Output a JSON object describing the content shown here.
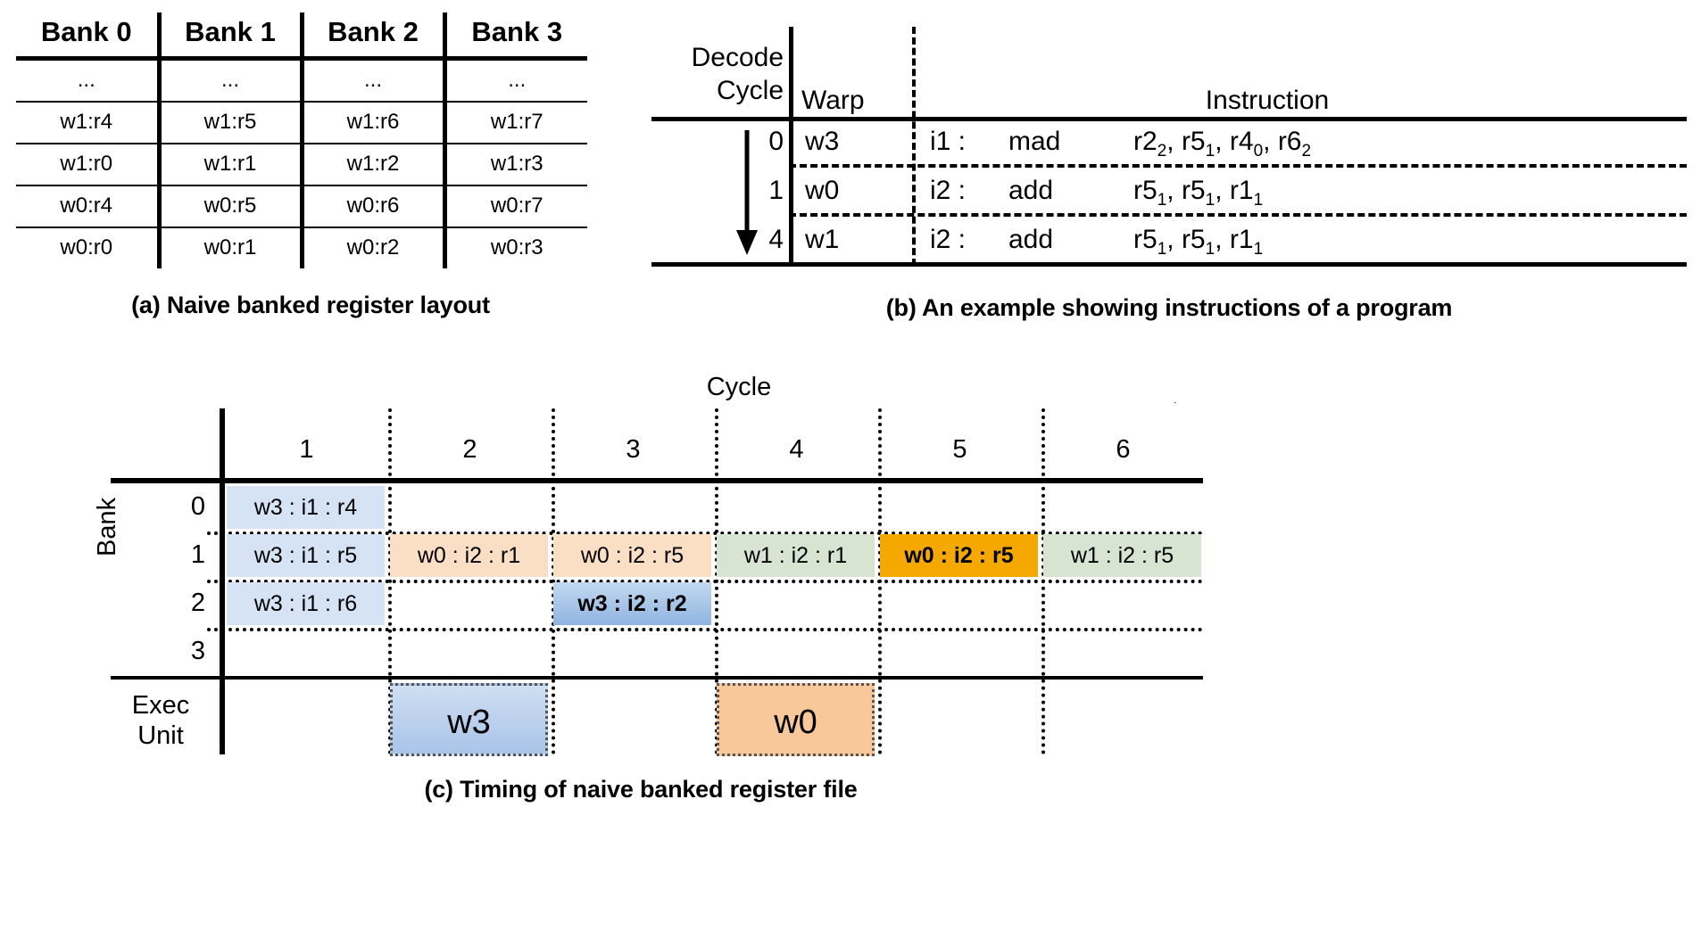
{
  "panel_a": {
    "caption": "(a) Naive banked register layout",
    "headers": [
      "Bank 0",
      "Bank 1",
      "Bank 2",
      "Bank 3"
    ],
    "rows": [
      [
        "...",
        "...",
        "...",
        "..."
      ],
      [
        "w1:r4",
        "w1:r5",
        "w1:r6",
        "w1:r7"
      ],
      [
        "w1:r0",
        "w1:r1",
        "w1:r2",
        "w1:r3"
      ],
      [
        "w0:r4",
        "w0:r5",
        "w0:r6",
        "w0:r7"
      ],
      [
        "w0:r0",
        "w0:r1",
        "w0:r2",
        "w0:r3"
      ]
    ]
  },
  "panel_b": {
    "caption": "(b) An example showing instructions of a program",
    "header": {
      "decode_cycle_line1": "Decode",
      "decode_cycle_line2": "Cycle",
      "warp": "Warp",
      "instruction": "Instruction"
    },
    "rows": [
      {
        "cycle": "0",
        "warp": "w3",
        "id": "i1 :",
        "mnemonic": "mad",
        "operands": [
          {
            "reg": "r2",
            "sub": "2",
            "sep": ", "
          },
          {
            "reg": "r5",
            "sub": "1",
            "sep": ", "
          },
          {
            "reg": "r4",
            "sub": "0",
            "sep": ", "
          },
          {
            "reg": "r6",
            "sub": "2",
            "sep": ""
          }
        ]
      },
      {
        "cycle": "1",
        "warp": "w0",
        "id": "i2 :",
        "mnemonic": "add",
        "operands": [
          {
            "reg": "r5",
            "sub": "1",
            "sep": ", "
          },
          {
            "reg": "r5",
            "sub": "1",
            "sep": ", "
          },
          {
            "reg": "r1",
            "sub": "1",
            "sep": ""
          }
        ]
      },
      {
        "cycle": "4",
        "warp": "w1",
        "id": "i2 :",
        "mnemonic": "add",
        "operands": [
          {
            "reg": "r5",
            "sub": "1",
            "sep": ", "
          },
          {
            "reg": "r5",
            "sub": "1",
            "sep": ", "
          },
          {
            "reg": "r1",
            "sub": "1",
            "sep": ""
          }
        ]
      }
    ]
  },
  "panel_c": {
    "caption": "(c) Timing of naive banked register file",
    "axis_label": "Cycle",
    "row_group_label": "Bank",
    "exec_label_line1": "Exec",
    "exec_label_line2": "Unit",
    "cycles": [
      "1",
      "2",
      "3",
      "4",
      "5",
      "6"
    ],
    "bank_rows": [
      "0",
      "1",
      "2",
      "3"
    ],
    "colors": {
      "blue_light": "#d6e3f5",
      "blue_strong": "#8fb4e0",
      "peach": "#fbdfc4",
      "green": "#d7e4d2",
      "orange": "#f5a800",
      "exec_blue": "#a9c4e8",
      "exec_orange": "#f8c89a"
    },
    "cells": [
      {
        "bank": "0",
        "cycle": "1",
        "text": "w3 : i1 : r4",
        "color": "blue_light",
        "bold": false
      },
      {
        "bank": "1",
        "cycle": "1",
        "text": "w3 : i1 : r5",
        "color": "blue_light",
        "bold": false
      },
      {
        "bank": "1",
        "cycle": "2",
        "text": "w0 : i2 : r1",
        "color": "peach",
        "bold": false
      },
      {
        "bank": "1",
        "cycle": "3",
        "text": "w0 : i2 : r5",
        "color": "peach",
        "bold": false
      },
      {
        "bank": "1",
        "cycle": "4",
        "text": "w1 : i2 : r1",
        "color": "green",
        "bold": false
      },
      {
        "bank": "1",
        "cycle": "5",
        "text": "w0 : i2 : r5",
        "color": "orange",
        "bold": true
      },
      {
        "bank": "1",
        "cycle": "6",
        "text": "w1 : i2 : r5",
        "color": "green",
        "bold": false
      },
      {
        "bank": "2",
        "cycle": "1",
        "text": "w3 : i1 : r6",
        "color": "blue_light",
        "bold": false
      },
      {
        "bank": "2",
        "cycle": "3",
        "text": "w3 : i2 : r2",
        "color": "blue_strong",
        "bold": true
      }
    ],
    "exec_cells": [
      {
        "cycle": "2",
        "text": "w3",
        "color": "exec_blue"
      },
      {
        "cycle": "4",
        "text": "w0",
        "color": "exec_orange"
      }
    ]
  }
}
